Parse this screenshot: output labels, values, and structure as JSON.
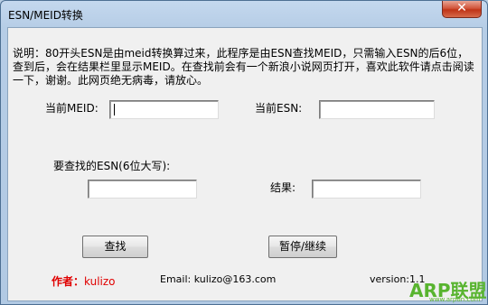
{
  "window": {
    "title": "ESN/MEID转换",
    "close_glyph": "✕"
  },
  "description": "说明：80开头ESN是由meid转换算过来，此程序是由ESN查找MEID，只需输入ESN的后6位，查到后，会在结果栏里显示MEID。在查找前会有一个新浪小说网页打开，喜欢此软件请点击阅读一下，谢谢。此网页绝无病毒，请放心。",
  "fields": {
    "meid_label": "当前MEID:",
    "meid_value": "",
    "esn_label": "当前ESN:",
    "esn_value": "",
    "search_esn_label": "要查找的ESN(6位大写):",
    "search_esn_value": "",
    "result_label": "结果:",
    "result_value": ""
  },
  "buttons": {
    "search": "查找",
    "pause": "暂停/继续"
  },
  "footer": {
    "author_label": "作者：",
    "author_name": "kulizo",
    "email": "Email: kulizo@163.com",
    "version": "version:1.1"
  },
  "watermark": {
    "brand": "ARP联盟",
    "url": "www.arpun.com"
  }
}
